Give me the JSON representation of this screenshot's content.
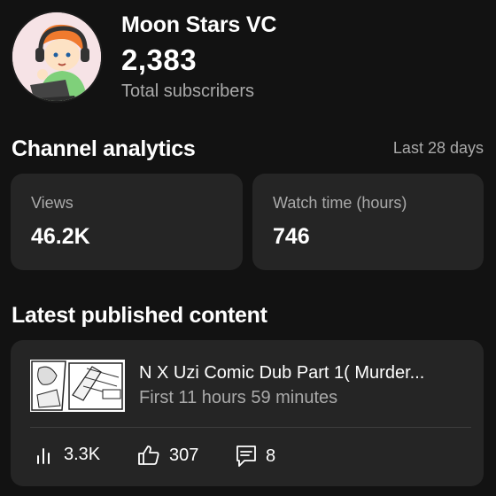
{
  "channel": {
    "name": "Moon Stars VC",
    "subscriber_count": "2,383",
    "subscriber_label": "Total subscribers"
  },
  "analytics": {
    "title": "Channel analytics",
    "period": "Last 28 days",
    "cards": [
      {
        "label": "Views",
        "value": "46.2K"
      },
      {
        "label": "Watch time (hours)",
        "value": "746"
      }
    ]
  },
  "latest": {
    "title": "Latest published content",
    "video": {
      "title": "N X Uzi Comic Dub Part 1( Murder...",
      "subtitle": "First 11 hours 59 minutes",
      "views": "3.3K",
      "likes": "307",
      "comments": "8"
    }
  },
  "icons": {
    "views": "bar-chart-icon",
    "likes": "thumbs-up-icon",
    "comments": "comment-icon"
  },
  "colors": {
    "background": "#121212",
    "card": "#252525",
    "secondary_text": "#aaaaaa"
  }
}
